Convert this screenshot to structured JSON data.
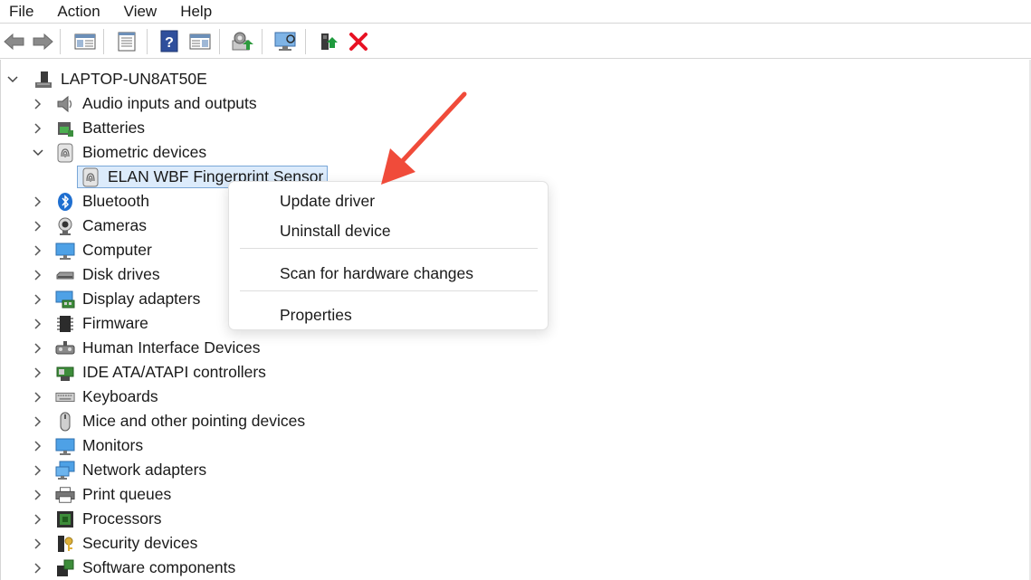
{
  "menubar": {
    "items": [
      "File",
      "Action",
      "View",
      "Help"
    ]
  },
  "toolbar": {
    "buttons": [
      "back-icon",
      "forward-icon",
      "show-hide-console-tree-icon",
      "properties-icon",
      "help-icon",
      "show-action-pane-icon",
      "scan-hardware-icon",
      "monitor-icon",
      "enable-device-icon",
      "uninstall-device-icon"
    ],
    "uninstall_color": "#e81123",
    "enable_color": "#1e9a3d"
  },
  "tree": {
    "root": "LAPTOP-UN8AT50E",
    "categories": [
      "Audio inputs and outputs",
      "Batteries",
      "Biometric devices",
      "Bluetooth",
      "Cameras",
      "Computer",
      "Disk drives",
      "Display adapters",
      "Firmware",
      "Human Interface Devices",
      "IDE ATA/ATAPI controllers",
      "Keyboards",
      "Mice and other pointing devices",
      "Monitors",
      "Network adapters",
      "Print queues",
      "Processors",
      "Security devices",
      "Software components"
    ],
    "expanded_category": "Biometric devices",
    "selected_device": "ELAN WBF Fingerprint Sensor"
  },
  "context_menu": {
    "items": [
      "Update driver",
      "Uninstall device",
      "Scan for hardware changes",
      "Properties"
    ]
  },
  "annotation": {
    "arrow_color": "#f04b3a"
  }
}
